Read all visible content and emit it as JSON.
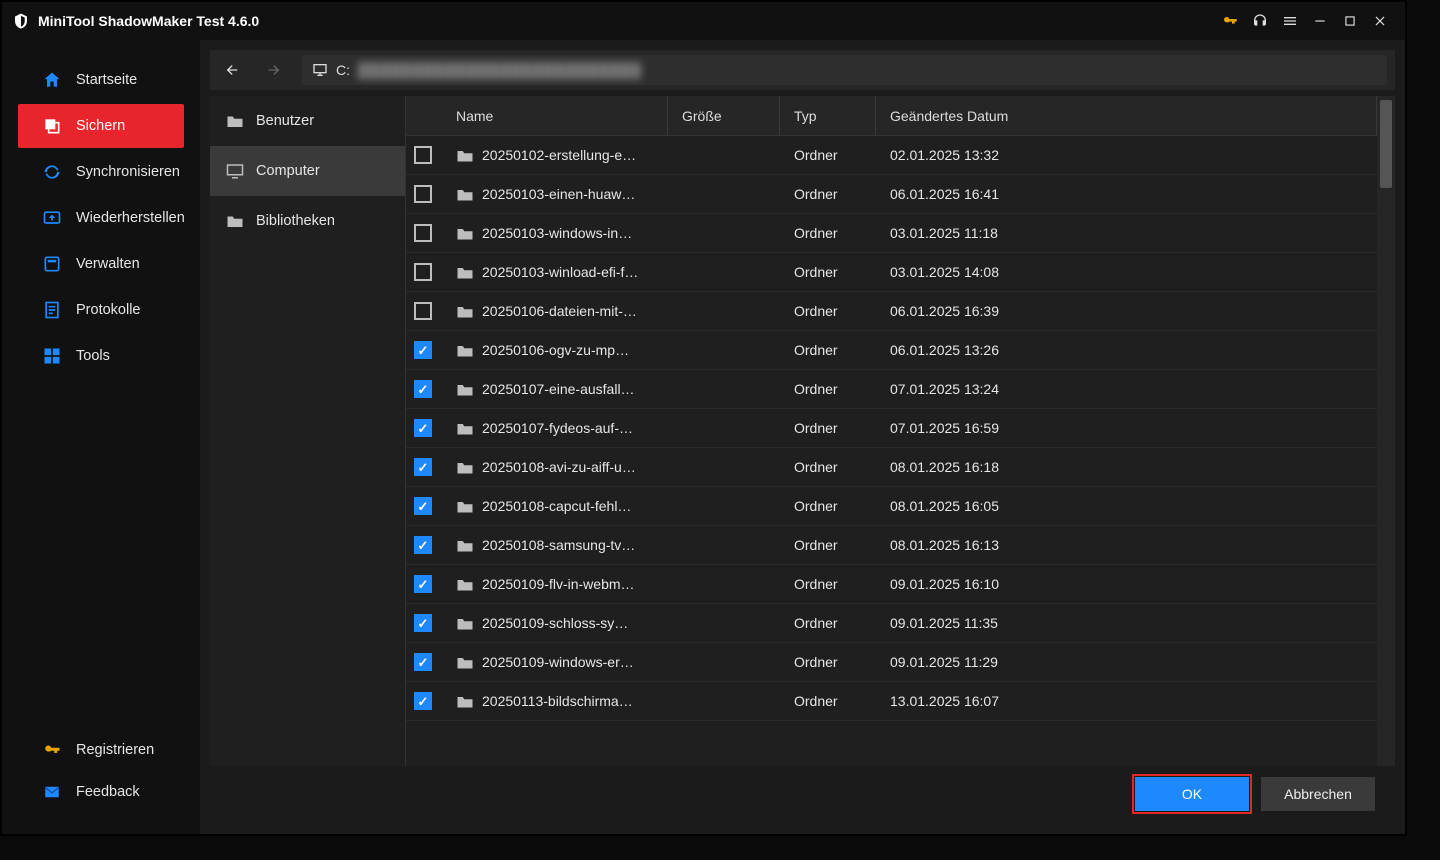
{
  "title": "MiniTool ShadowMaker Test 4.6.0",
  "sidebar": {
    "items": [
      {
        "label": "Startseite"
      },
      {
        "label": "Sichern"
      },
      {
        "label": "Synchronisieren"
      },
      {
        "label": "Wiederherstellen"
      },
      {
        "label": "Verwalten"
      },
      {
        "label": "Protokolle"
      },
      {
        "label": "Tools"
      }
    ],
    "footer": [
      {
        "label": "Registrieren"
      },
      {
        "label": "Feedback"
      }
    ]
  },
  "path": {
    "drive": "C:"
  },
  "tree": {
    "items": [
      {
        "label": "Benutzer"
      },
      {
        "label": "Computer"
      },
      {
        "label": "Bibliotheken"
      }
    ]
  },
  "columns": {
    "name": "Name",
    "size": "Größe",
    "type": "Typ",
    "date": "Geändertes Datum"
  },
  "typeLabel": "Ordner",
  "rows": [
    {
      "name": "20250102-erstellung-e…",
      "date": "02.01.2025 13:32",
      "checked": false
    },
    {
      "name": "20250103-einen-huaw…",
      "date": "06.01.2025 16:41",
      "checked": false
    },
    {
      "name": "20250103-windows-in…",
      "date": "03.01.2025 11:18",
      "checked": false
    },
    {
      "name": "20250103-winload-efi-f…",
      "date": "03.01.2025 14:08",
      "checked": false
    },
    {
      "name": "20250106-dateien-mit-…",
      "date": "06.01.2025 16:39",
      "checked": false
    },
    {
      "name": "20250106-ogv-zu-mp…",
      "date": "06.01.2025 13:26",
      "checked": true
    },
    {
      "name": "20250107-eine-ausfall…",
      "date": "07.01.2025 13:24",
      "checked": true
    },
    {
      "name": "20250107-fydeos-auf-…",
      "date": "07.01.2025 16:59",
      "checked": true
    },
    {
      "name": "20250108-avi-zu-aiff-u…",
      "date": "08.01.2025 16:18",
      "checked": true
    },
    {
      "name": "20250108-capcut-fehl…",
      "date": "08.01.2025 16:05",
      "checked": true
    },
    {
      "name": "20250108-samsung-tv…",
      "date": "08.01.2025 16:13",
      "checked": true
    },
    {
      "name": "20250109-flv-in-webm…",
      "date": "09.01.2025 16:10",
      "checked": true
    },
    {
      "name": "20250109-schloss-sy…",
      "date": "09.01.2025 11:35",
      "checked": true
    },
    {
      "name": "20250109-windows-er…",
      "date": "09.01.2025 11:29",
      "checked": true
    },
    {
      "name": "20250113-bildschirma…",
      "date": "13.01.2025 16:07",
      "checked": true
    }
  ],
  "buttons": {
    "ok": "OK",
    "cancel": "Abbrechen"
  }
}
